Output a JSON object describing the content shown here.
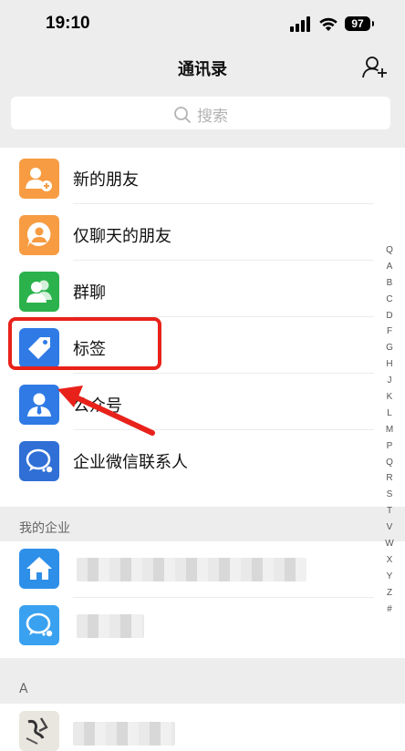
{
  "status": {
    "time": "19:10",
    "battery": "97"
  },
  "nav": {
    "title": "通讯录"
  },
  "search": {
    "placeholder": "搜索"
  },
  "items": [
    {
      "label": "新的朋友",
      "color": "#f79c42",
      "icon": "add-person-icon"
    },
    {
      "label": "仅聊天的朋友",
      "color": "#f79c42",
      "icon": "chat-person-icon"
    },
    {
      "label": "群聊",
      "color": "#2bb24c",
      "icon": "group-icon"
    },
    {
      "label": "标签",
      "color": "#2f7ae5",
      "icon": "tag-icon"
    },
    {
      "label": "公众号",
      "color": "#2f7ae5",
      "icon": "official-account-icon"
    },
    {
      "label": "企业微信联系人",
      "color": "#2f6fd6",
      "icon": "wecom-icon"
    }
  ],
  "sections": {
    "enterprise": "我的企业",
    "letter_a": "A"
  },
  "alphabet": [
    "Q",
    "A",
    "B",
    "C",
    "D",
    "F",
    "G",
    "H",
    "J",
    "K",
    "L",
    "M",
    "P",
    "Q",
    "R",
    "S",
    "T",
    "V",
    "W",
    "X",
    "Y",
    "Z",
    "#"
  ]
}
